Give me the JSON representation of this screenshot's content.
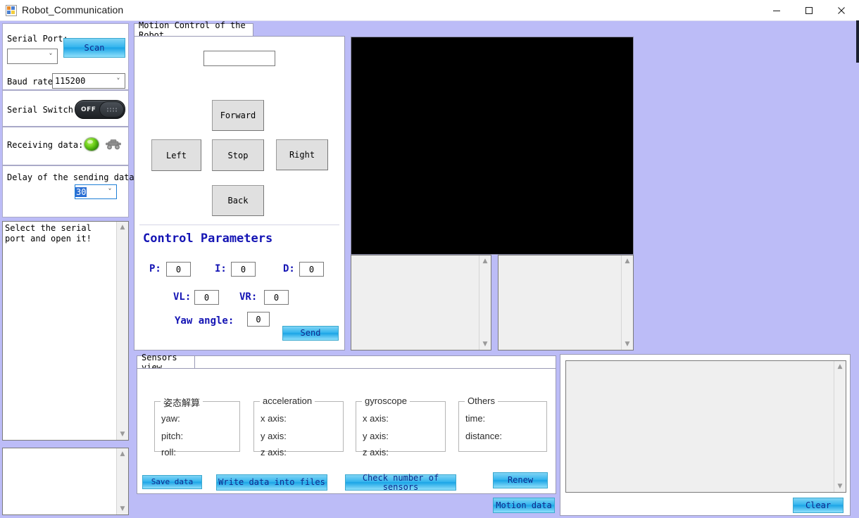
{
  "window": {
    "title": "Robot_Communication",
    "icon": "app-icon",
    "minimize": "—",
    "maximize": "□",
    "close": "✕"
  },
  "sidebar": {
    "serial_port": {
      "label": "Serial Port:",
      "value": "",
      "scan_button": "Scan"
    },
    "baud_rate": {
      "label": "Baud rate:",
      "value": "115200"
    },
    "serial_switch": {
      "label": "Serial Switch:",
      "state": "OFF"
    },
    "receiving_data": {
      "label": "Receiving data:",
      "led": "green-led-icon",
      "robot": "robot-car-icon"
    },
    "delay": {
      "label": "Delay of the sending data:",
      "value": "30"
    },
    "log": {
      "text": "Select the serial port and open it!"
    },
    "log2": {
      "text": ""
    }
  },
  "motion_tab": {
    "title": "Motion Control of the Robot",
    "status_input": "",
    "buttons": {
      "forward": "Forward",
      "left": "Left",
      "stop": "Stop",
      "right": "Right",
      "back": "Back"
    },
    "control_parameters": {
      "heading": "Control Parameters",
      "p_label": "P:",
      "p_value": "0",
      "i_label": "I:",
      "i_value": "0",
      "d_label": "D:",
      "d_value": "0",
      "vl_label": "VL:",
      "vl_value": "0",
      "vr_label": "VR:",
      "vr_value": "0",
      "yaw_label": "Yaw angle:",
      "yaw_value": "0",
      "send_button": "Send"
    }
  },
  "video": {
    "caption": "video-stream-view"
  },
  "side_lists": {
    "left_text": "",
    "right_text": ""
  },
  "sensors_tab": {
    "title": "Sensors view",
    "groups": [
      {
        "caption": "姿态解算",
        "rows": [
          "yaw:",
          "pitch:",
          "roll:"
        ]
      },
      {
        "caption": "acceleration",
        "rows": [
          "x axis:",
          "y axis:",
          "z axis:"
        ]
      },
      {
        "caption": "gyroscope",
        "rows": [
          "x axis:",
          "y axis:",
          "z axis:"
        ]
      },
      {
        "caption": "Others",
        "rows": [
          "time:",
          "distance:"
        ]
      }
    ],
    "buttons": {
      "save_data": "Save data",
      "write_files": "Write data into files",
      "check_sensors": "Check number of sensors",
      "renew": "Renew",
      "motion_data": "Motion data"
    }
  },
  "console": {
    "text": "",
    "clear_button": "Clear"
  },
  "colors": {
    "window_bg": "#bcbcf7",
    "accent_button": "#35b5ee",
    "button_text": "#102a8c",
    "heading_blue": "#1414b4",
    "led_green": "#6fd11a",
    "video_bg": "#000000"
  }
}
